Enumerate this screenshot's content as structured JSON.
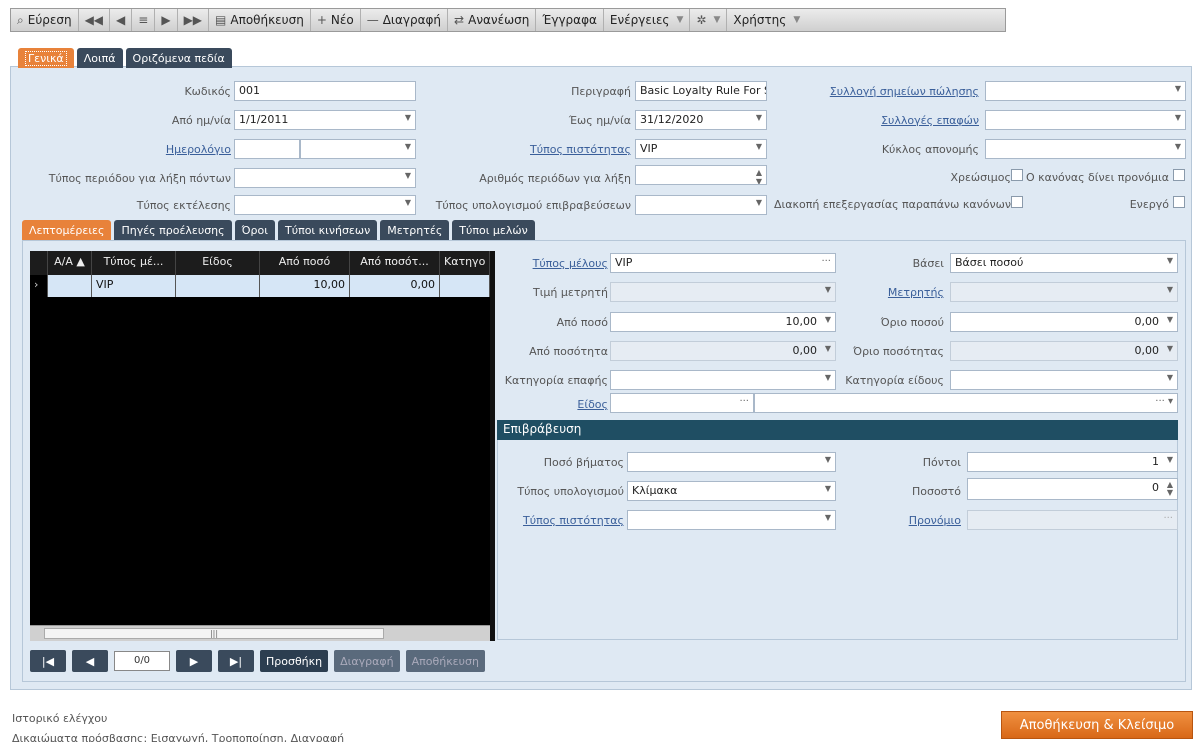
{
  "toolbar": {
    "find": "Εύρεση",
    "save": "Αποθήκευση",
    "new": "Νέο",
    "delete": "Διαγραφή",
    "refresh": "Ανανέωση",
    "documents": "Έγγραφα",
    "actions": "Ενέργειες",
    "user": "Χρήστης"
  },
  "tabs": [
    "Γενικά",
    "Λοιπά",
    "Οριζόμενα πεδία"
  ],
  "form": {
    "code_label": "Κωδικός",
    "code_value": "001",
    "from_date_label": "Από ημ/νία",
    "from_date_value": "1/1/2011",
    "calendar_label": "Ημερολόγιο",
    "points_period_label": "Τύπος περιόδου για λήξη πόντων",
    "exec_type_label": "Τύπος εκτέλεσης",
    "desc_label": "Περιγραφή",
    "desc_value": "Basic Loyalty Rule For S",
    "to_date_label": "Έως ημ/νία",
    "to_date_value": "31/12/2020",
    "loyalty_type_label": "Τύπος πιστότητας",
    "loyalty_type_value": "VIP",
    "periods_label": "Αριθμός περιόδων για λήξη",
    "reward_calc_label": "Τύπος υπολογισμού επιβραβεύσεων",
    "pos_collection_label": "Συλλογή σημείων πώλησης",
    "contact_collections_label": "Συλλογές επαφών",
    "distribution_cycle_label": "Κύκλος απονομής",
    "debit_label": "Χρεώσιμος",
    "privilege_label": "Ο κανόνας δίνει προνόμια",
    "stop_label": "Διακοπή επεξεργασίας παραπάνω κανόνων",
    "active_label": "Ενεργό"
  },
  "inner_tabs": [
    "Λεπτομέρειες",
    "Πηγές προέλευσης",
    "Όροι",
    "Τύποι κινήσεων",
    "Μετρητές",
    "Τύποι μελών"
  ],
  "grid": {
    "columns": [
      "Α/Α ▲",
      "Τύπος μέ...",
      "Είδος",
      "Από ποσό",
      "Από ποσότ...",
      "Κατηγο"
    ],
    "rows": [
      {
        "aa": "",
        "type": "VIP",
        "item": "",
        "from_amount": "10,00",
        "from_qty": "0,00",
        "category": ""
      }
    ]
  },
  "pager": {
    "page": "0/0",
    "add": "Προσθήκη",
    "delete": "Διαγραφή",
    "save": "Αποθήκευση"
  },
  "details": {
    "member_type_label": "Τύπος μέλους",
    "member_type_value": "VIP",
    "counter_value_label": "Τιμή μετρητή",
    "from_amount_label": "Από ποσό",
    "from_amount_value": "10,00",
    "from_qty_label": "Από ποσότητα",
    "from_qty_value": "0,00",
    "contact_cat_label": "Κατηγορία επαφής",
    "item_label": "Είδος",
    "basis_label": "Βάσει",
    "basis_value": "Βάσει ποσού",
    "counters_label": "Μετρητής",
    "amount_limit_label": "Όριο ποσού",
    "amount_limit_value": "0,00",
    "qty_limit_label": "Όριο ποσότητας",
    "qty_limit_value": "0,00",
    "item_cat_label": "Κατηγορία είδους"
  },
  "reward": {
    "title": "Επιβράβευση",
    "step_label": "Ποσό βήματος",
    "calc_type_label": "Τύπος υπολογισμού",
    "calc_type_value": "Κλίμακα",
    "loyalty_type_label": "Τύπος πιστότητας",
    "points_label": "Πόντοι",
    "points_value": "1",
    "percent_label": "Ποσοστό",
    "percent_value": "0",
    "privilege_label": "Προνόμιο"
  },
  "footer": {
    "history": "Ιστορικό ελέγχου",
    "permissions": "Δικαιώματα πρόσβασης: Εισαγωγή, Τροποποίηση, Διαγραφή",
    "save_close": "Αποθήκευση & Κλείσιμο"
  }
}
